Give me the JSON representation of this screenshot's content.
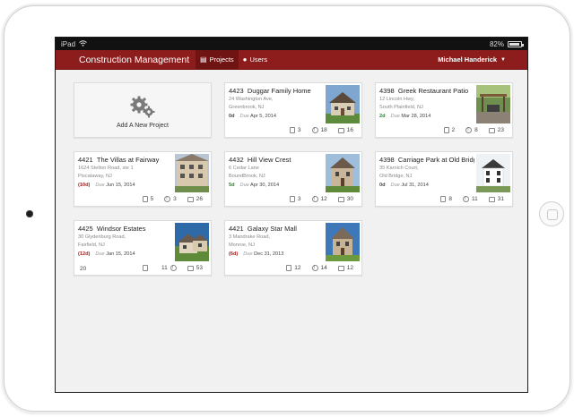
{
  "status_bar": {
    "device": "iPad",
    "time": "",
    "battery": "82%"
  },
  "app": {
    "title": "Construction Management",
    "nav": [
      {
        "label": "Projects",
        "icon": "building-icon"
      },
      {
        "label": "Users",
        "icon": "user-icon"
      }
    ],
    "user": "Michael Handerick"
  },
  "add_project": {
    "label": "Add A New Project",
    "icon": "gears-icon"
  },
  "due_label": "Due",
  "projects": [
    {
      "id": "4423",
      "name": "Duggar Family Home",
      "address1": "24 Washington Ave,",
      "address2": "Greenbrook, NJ",
      "days": "0d",
      "days_status": "neutral",
      "due": "Apr 5, 2014",
      "docs": "3",
      "alerts": "18",
      "messages": "16"
    },
    {
      "id": "4398",
      "name": "Greek Restaurant Patio",
      "address1": "12 Lincoln Hwy,",
      "address2": "South Plainfield, NJ",
      "days": "2d",
      "days_status": "green",
      "due": "Mar 28, 2014",
      "docs": "2",
      "alerts": "8",
      "messages": "23"
    },
    {
      "id": "4421",
      "name": "The Villas at Fairway",
      "address1": "1624 Stelton Road, ste 1",
      "address2": "Piscataway, NJ",
      "days": "(10d)",
      "days_status": "red",
      "due": "Jun 15, 2014",
      "docs": "5",
      "alerts": "3",
      "messages": "26"
    },
    {
      "id": "4432",
      "name": "Hill View Crest",
      "address1": "6 Cedar Lane",
      "address2": "BoundBrook, NJ",
      "days": "5d",
      "days_status": "green",
      "due": "Apr 30, 2014",
      "docs": "3",
      "alerts": "12",
      "messages": "30"
    },
    {
      "id": "4398",
      "name": "Carriage Park at Old Bridge",
      "address1": "35 Karnich Court,",
      "address2": "Old Bridge, NJ",
      "days": "0d",
      "days_status": "neutral",
      "due": "Jul 31, 2014",
      "docs": "8",
      "alerts": "11",
      "messages": "31"
    },
    {
      "id": "4425",
      "name": "Windsor Estates",
      "address1": "30 Glydenburg Road,",
      "address2": "Fairfield, NJ",
      "days": "(12d)",
      "days_status": "red",
      "due": "Jan 15, 2014",
      "count_left": "20",
      "docs": "",
      "alerts": "11",
      "messages": "53"
    },
    {
      "id": "4421",
      "name": "Galaxy Star Mall",
      "address1": "3 Mandrake Road,",
      "address2": "Monroe, NJ",
      "days": "(6d)",
      "days_status": "red",
      "due": "Dec 31, 2013",
      "docs": "12",
      "alerts": "14",
      "messages": "12"
    }
  ],
  "colors": {
    "brand": "#8d1c1c",
    "late": "#a51d1d",
    "ahead": "#2f7a2f"
  }
}
